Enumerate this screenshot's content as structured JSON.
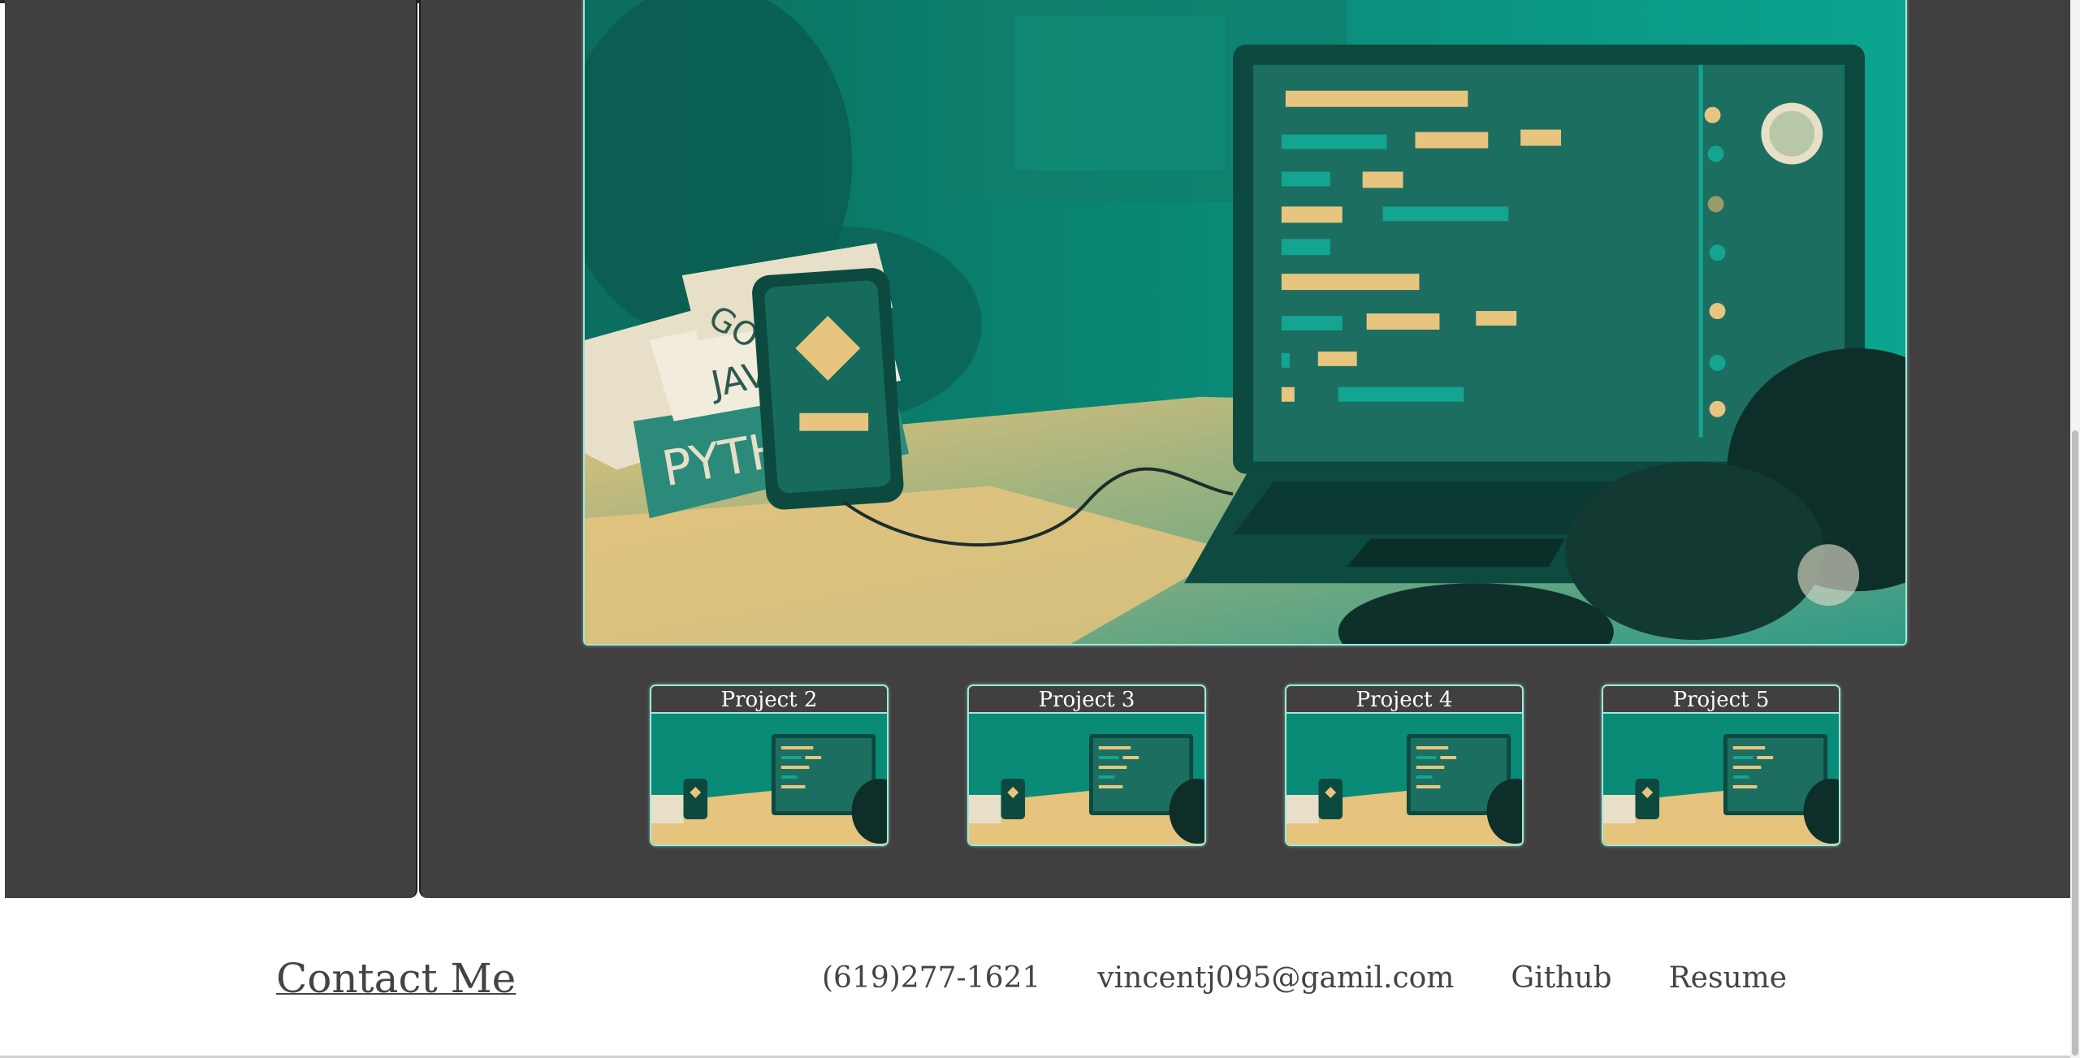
{
  "projects": [
    {
      "title": "Project 2"
    },
    {
      "title": "Project 3"
    },
    {
      "title": "Project 4"
    },
    {
      "title": "Project 5"
    }
  ],
  "footer": {
    "contact_title": "Contact Me",
    "phone": "(619)277-1621",
    "email": "vincentj095@gamil.com",
    "github_label": "Github",
    "resume_label": "Resume"
  },
  "hero_image": {
    "book_labels": [
      "PYTHON",
      "JAVA",
      "JAVA",
      "GO"
    ]
  },
  "colors": {
    "panel_bg": "#413f40",
    "accent_border": "#9ee9d7",
    "teal": "#0a9a87",
    "sand": "#e8c57f",
    "footer_text": "#444444"
  }
}
